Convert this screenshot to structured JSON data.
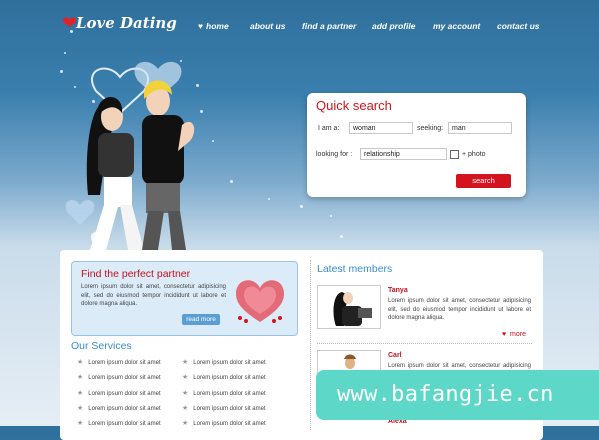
{
  "logo": {
    "text": "Love Dating",
    "icon": "heart-icon"
  },
  "nav": {
    "items": [
      {
        "label": "home",
        "icon": "heart-icon"
      },
      {
        "label": "about us"
      },
      {
        "label": "find a partner"
      },
      {
        "label": "add profile"
      },
      {
        "label": "my account"
      },
      {
        "label": "contact us"
      }
    ]
  },
  "quick_search": {
    "title": "Quick search",
    "i_am_label": "I am a:",
    "i_am_value": "woman",
    "seeking_label": "seeking:",
    "seeking_value": "man",
    "looking_for_label": "looking for :",
    "looking_for_value": "relationship",
    "photo_label": "+ photo",
    "search_button": "search"
  },
  "find_partner": {
    "title": "Find the perfect partner",
    "text": "Lorem ipsum dolor sit amet, consectetur adipisicing elit, sed do eiusmod tempor incididunt ut labore et dolore magna aliqua.",
    "read_more": "read more"
  },
  "services": {
    "title": "Our Services",
    "left": [
      "Lorem ipsum dolor sit amet",
      "Lorem ipsum dolor sit amet",
      "Lorem ipsum dolor sit amet",
      "Lorem ipsum dolor sit amet",
      "Lorem ipsum dolor sit amet"
    ],
    "right": [
      "Lorem ipsum dolor sit amet",
      "Lorem ipsum dolor sit amet",
      "Lorem ipsum dolor sit amet",
      "Lorem ipsum dolor sit amet",
      "Lorem ipsum dolor sit amet"
    ]
  },
  "latest_members": {
    "title": "Latest members",
    "members": [
      {
        "name": "Tanya",
        "text": "Lorem ipsum dolor sit amet, consectetur adipisicing elit, sed do eiusmod tempor incididunt ut labore et dolore magna aliqua.",
        "more": "more"
      },
      {
        "name": "Carl",
        "text": "Lorem ipsum dolor sit amet, consectetur adipisicing elit, sed do eiusmod tempor incididunt ut labore et dolore magna aliqua."
      },
      {
        "name": "Alexa"
      }
    ]
  },
  "watermark": {
    "text": "www.bafangjie.cn"
  },
  "colors": {
    "accent_red": "#d2141e",
    "heading_blue": "#3a8dd1",
    "header_blue": "#2f6f9c"
  }
}
